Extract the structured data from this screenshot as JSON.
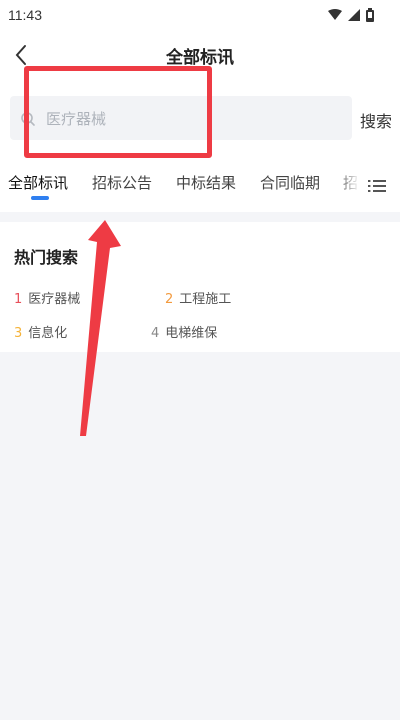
{
  "status_bar": {
    "time": "11:43"
  },
  "header": {
    "title": "全部标讯"
  },
  "search": {
    "placeholder": "医疗器械",
    "button_label": "搜索"
  },
  "tabs": [
    {
      "label": "全部标讯",
      "active": true
    },
    {
      "label": "招标公告"
    },
    {
      "label": "中标结果"
    },
    {
      "label": "合同临期"
    },
    {
      "label": "招"
    }
  ],
  "hot_search": {
    "title": "热门搜索",
    "items": [
      {
        "rank": "1",
        "label": "医疗器械",
        "rank_color": "#e8505b"
      },
      {
        "rank": "2",
        "label": "工程施工",
        "rank_color": "#f39a3e"
      },
      {
        "rank": "3",
        "label": "信息化",
        "rank_color": "#f5b33a"
      },
      {
        "rank": "4",
        "label": "电梯维保",
        "rank_color": "#888888"
      }
    ]
  },
  "colors": {
    "accent": "#2f7ff0",
    "annotation": "#ee3b44"
  }
}
